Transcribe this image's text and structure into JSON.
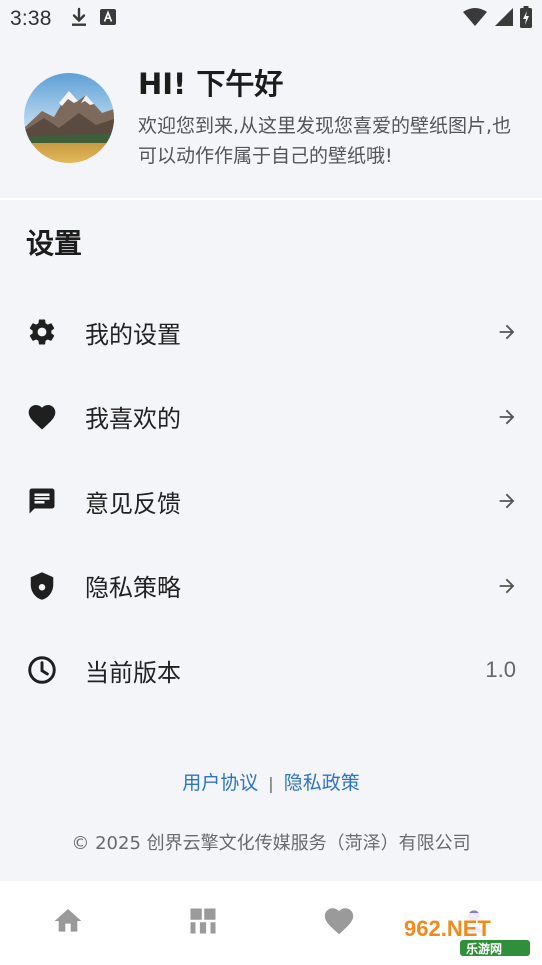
{
  "status_bar": {
    "time": "3:38",
    "icons": [
      "download-icon",
      "keyboard-a-icon",
      "wifi-icon",
      "signal-icon",
      "battery-charging-icon"
    ]
  },
  "header": {
    "avatar": "mountain-landscape-avatar",
    "greeting": "HI! 下午好",
    "welcome": "欢迎您到来,从这里发现您喜爱的壁纸图片,也可以动作作属于自己的壁纸哦!"
  },
  "settings": {
    "title": "设置",
    "items": [
      {
        "label": "我的设置",
        "icon": "gear-icon",
        "trail": "arrow-right-icon"
      },
      {
        "label": "我喜欢的",
        "icon": "heart-icon",
        "trail": "arrow-right-icon"
      },
      {
        "label": "意见反馈",
        "icon": "feedback-icon",
        "trail": "arrow-right-icon"
      },
      {
        "label": "隐私策略",
        "icon": "shield-icon",
        "trail": "arrow-right-icon"
      },
      {
        "label": "当前版本",
        "icon": "clock-icon",
        "value": "1.0"
      }
    ]
  },
  "links": {
    "user_agreement": "用户协议",
    "separator": "|",
    "privacy_policy": "隐私政策"
  },
  "footer": {
    "copyright": "© 2025 创界云擎文化传媒服务（菏泽）有限公司"
  },
  "bottom_nav": {
    "items": [
      "home-icon",
      "grid-icon",
      "heart-icon",
      "profile-icon"
    ]
  },
  "watermark": {
    "text_top": "962.NET",
    "text_bottom": "乐游网"
  },
  "colors": {
    "background": "#f4f5f9",
    "link": "#2f73c8",
    "nav_icon": "#9a9a9a"
  }
}
